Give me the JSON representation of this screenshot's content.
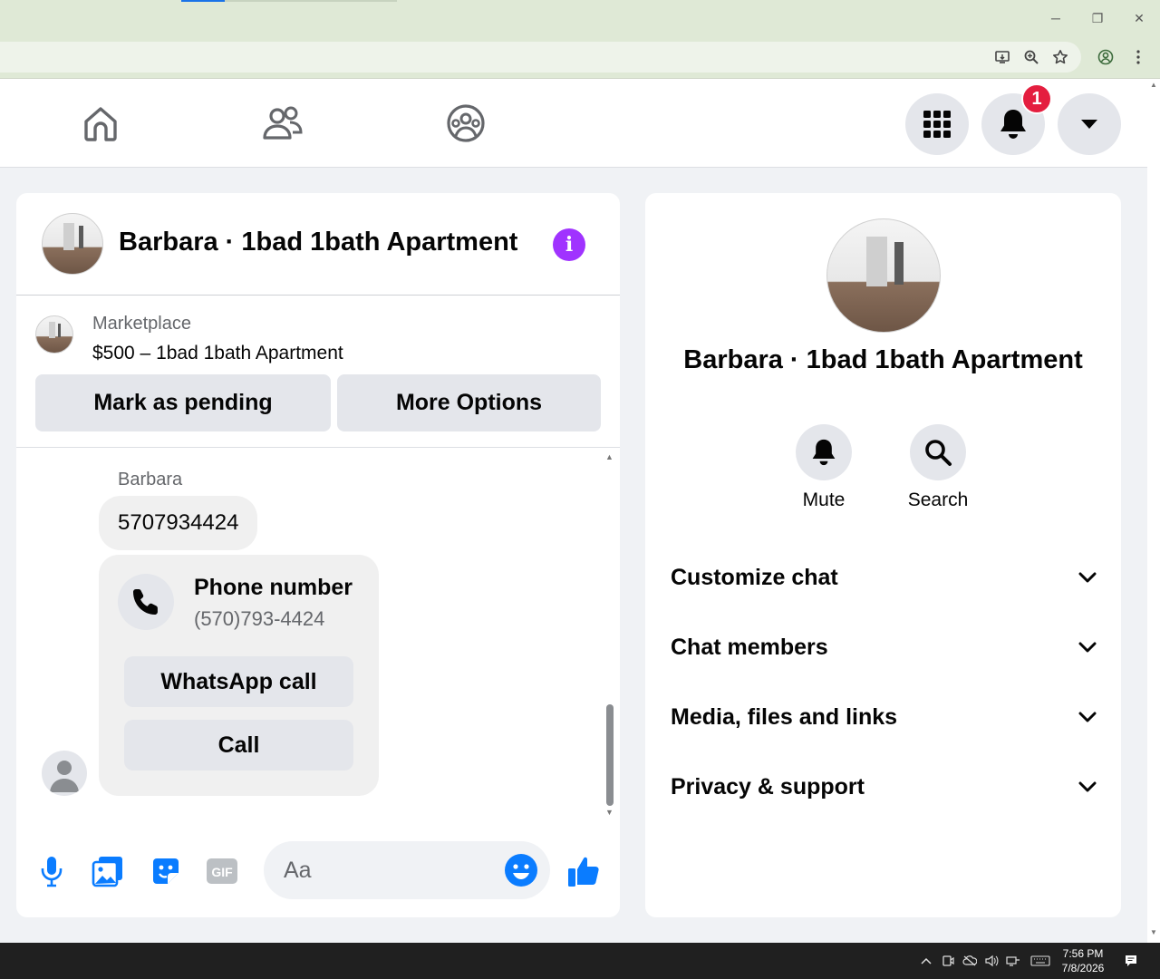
{
  "browser": {
    "window_controls": {
      "minimize": "─",
      "restore": "❐",
      "close": "✕"
    }
  },
  "nav": {
    "notifications_count": "1"
  },
  "chat": {
    "title": "Barbara · 1bad 1bath Apartment",
    "marketplace": {
      "label": "Marketplace",
      "listing": "$500 – 1bad 1bath Apartment",
      "mark_pending_label": "Mark as pending",
      "more_options_label": "More Options"
    },
    "messages": {
      "sender": "Barbara",
      "text": "5707934424",
      "phone_card": {
        "title": "Phone number",
        "number": "(570)793-4424",
        "whatsapp_label": "WhatsApp call",
        "call_label": "Call"
      }
    },
    "composer": {
      "placeholder": "Aa"
    }
  },
  "info_panel": {
    "title": "Barbara · 1bad 1bath Apartment",
    "actions": [
      {
        "label": "Mute",
        "icon": "bell-icon"
      },
      {
        "label": "Search",
        "icon": "search-icon"
      }
    ],
    "sections": [
      {
        "label": "Customize chat"
      },
      {
        "label": "Chat members"
      },
      {
        "label": "Media, files and links"
      },
      {
        "label": "Privacy & support"
      }
    ]
  },
  "taskbar": {
    "time": "7:56 PM",
    "date": "7/8/2026"
  },
  "colors": {
    "accent_blue": "#0a7cff",
    "info_purple": "#a033ff",
    "badge_red": "#e41e3f"
  }
}
